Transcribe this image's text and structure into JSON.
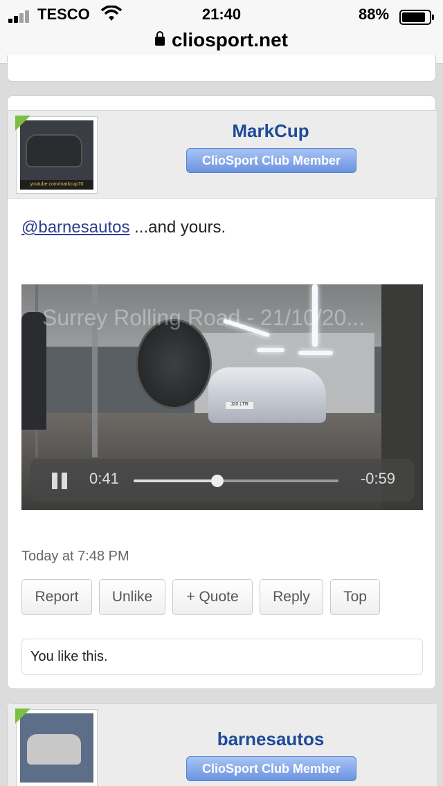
{
  "status_bar": {
    "carrier": "TESCO",
    "time": "21:40",
    "battery": "88%",
    "battery_level": 0.88
  },
  "url_bar": {
    "domain": "cliosport.net"
  },
  "post": {
    "username": "MarkCup",
    "user_title": "ClioSport Club Member",
    "avatar_caption": "youtube.com/markcup70",
    "mention": "@barnesautos",
    "message": " ...and yours.",
    "video": {
      "title": "Surrey Rolling Road - 21/10/20...",
      "plate": "J20 LTR",
      "elapsed": "0:41",
      "remaining": "-0:59",
      "progress": 0.41
    },
    "timestamp": "Today at 7:48 PM",
    "actions": [
      "Report",
      "Unlike",
      "+ Quote",
      "Reply",
      "Top"
    ],
    "likes_text": "You like this."
  },
  "next_post": {
    "username": "barnesautos",
    "user_title": "ClioSport Club Member"
  },
  "colors": {
    "accent": "#1e4a9a",
    "badge": "#6b93e0",
    "online": "#7bc043"
  }
}
